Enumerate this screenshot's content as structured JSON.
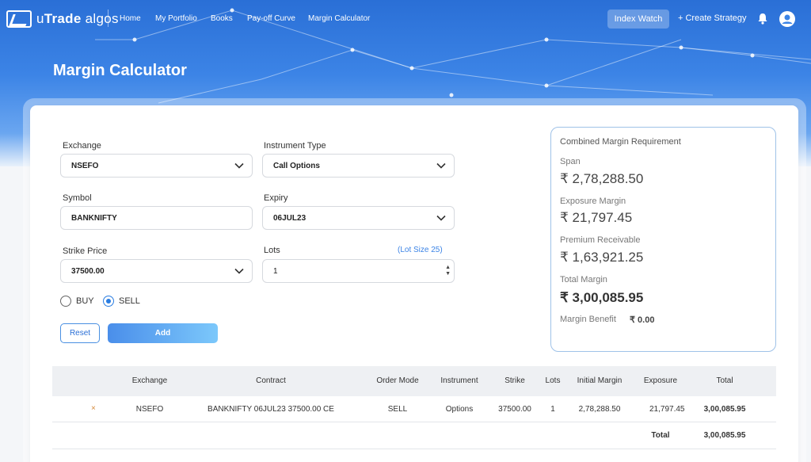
{
  "brand": {
    "name_prefix": "u",
    "name_main": "Trade",
    "name_suffix": "algos"
  },
  "nav": {
    "links": [
      "Home",
      "My Portfolio",
      "Books",
      "Pay-off Curve",
      "Margin Calculator"
    ],
    "index_watch": "Index Watch",
    "create_strategy": "+ Create Strategy"
  },
  "page_title": "Margin Calculator",
  "form": {
    "exchange": {
      "label": "Exchange",
      "value": "NSEFO"
    },
    "instrument_type": {
      "label": "Instrument Type",
      "value": "Call Options"
    },
    "symbol": {
      "label": "Symbol",
      "value": "BANKNIFTY"
    },
    "expiry": {
      "label": "Expiry",
      "value": "06JUL23"
    },
    "strike_price": {
      "label": "Strike Price",
      "value": "37500.00"
    },
    "lots": {
      "label": "Lots",
      "value": "1",
      "lot_size": "(Lot Size 25)"
    },
    "side": {
      "buy": "BUY",
      "sell": "SELL",
      "selected": "SELL"
    },
    "reset": "Reset",
    "add": "Add"
  },
  "summary": {
    "title": "Combined Margin Requirement",
    "span_label": "Span",
    "span_value": "₹ 2,78,288.50",
    "exposure_label": "Exposure Margin",
    "exposure_value": "₹ 21,797.45",
    "premium_label": "Premium Receivable",
    "premium_value": "₹ 1,63,921.25",
    "total_label": "Total Margin",
    "total_value": "₹ 3,00,085.95",
    "benefit_label": "Margin Benefit",
    "benefit_value": "₹ 0.00"
  },
  "table": {
    "headers": [
      "Exchange",
      "Contract",
      "Order Mode",
      "Instrument",
      "Strike",
      "Lots",
      "Initial Margin",
      "Exposure",
      "Total"
    ],
    "rows": [
      {
        "remove": "×",
        "exchange": "NSEFO",
        "contract": "BANKNIFTY 06JUL23 37500.00 CE",
        "order_mode": "SELL",
        "instrument": "Options",
        "strike": "37500.00",
        "lots": "1",
        "initial_margin": "2,78,288.50",
        "exposure": "21,797.45",
        "total": "3,00,085.95"
      }
    ],
    "total_label": "Total",
    "total_value": "3,00,085.95"
  },
  "colors": {
    "accent": "#2a7de1",
    "header_bg": "#2a6fd6"
  }
}
